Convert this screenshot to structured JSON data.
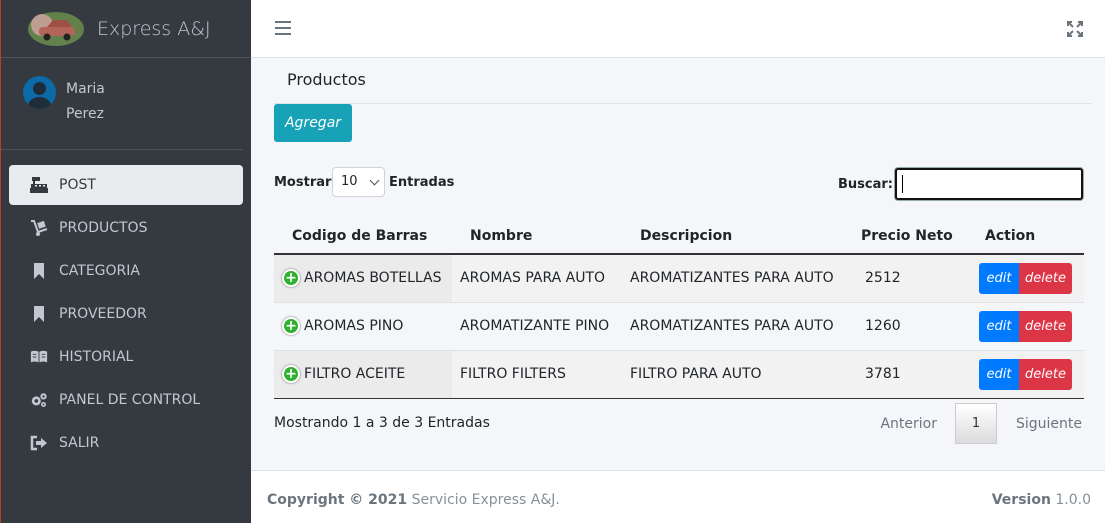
{
  "brand": {
    "name": "Express A&J"
  },
  "user": {
    "first_name": "Maria",
    "last_name": "Perez"
  },
  "sidebar": {
    "items": [
      {
        "label": "POST",
        "icon": "cash-register-icon",
        "active": true
      },
      {
        "label": "PRODUCTOS",
        "icon": "dolly-icon"
      },
      {
        "label": "CATEGORIA",
        "icon": "bookmark-icon"
      },
      {
        "label": "PROVEEDOR",
        "icon": "bookmark-icon"
      },
      {
        "label": "HISTORIAL",
        "icon": "book-open-icon"
      },
      {
        "label": "PANEL DE CONTROL",
        "icon": "cogs-icon"
      },
      {
        "label": "SALIR",
        "icon": "sign-out-icon"
      }
    ]
  },
  "main": {
    "title": "Productos",
    "add_label": "Agregar",
    "length_label": "Mostrar",
    "length_value": "10",
    "length_suffix": "Entradas",
    "search_label": "Buscar:",
    "search_value": "",
    "columns": [
      "Codigo de Barras",
      "Nombre",
      "Descripcion",
      "Precio Neto",
      "Action"
    ],
    "rows": [
      {
        "codigo": "AROMAS BOTELLAS",
        "nombre": "AROMAS PARA AUTO",
        "descripcion": "AROMATIZANTES PARA AUTO",
        "precio": "2512"
      },
      {
        "codigo": "AROMAS PINO",
        "nombre": "AROMATIZANTE PINO",
        "descripcion": "AROMATIZANTES PARA AUTO",
        "precio": "1260"
      },
      {
        "codigo": "FILTRO ACEITE",
        "nombre": "FILTRO FILTERS",
        "descripcion": "FILTRO PARA AUTO",
        "precio": "3781"
      }
    ],
    "edit_label": "edit",
    "delete_label": "delete",
    "info": "Mostrando 1 a 3 de 3 Entradas",
    "pager": {
      "prev": "Anterior",
      "current": "1",
      "next": "Siguiente"
    }
  },
  "footer": {
    "copyright": "Copyright © 2021",
    "company": "Servicio Express A&J.",
    "version_label": "Version",
    "version": "1.0.0"
  },
  "colors": {
    "sidebar": "#343a40",
    "accent": "#17a2b8",
    "edit": "#007bff",
    "delete": "#dc3545"
  }
}
